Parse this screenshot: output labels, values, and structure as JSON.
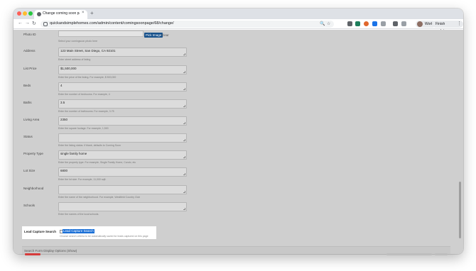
{
  "browser": {
    "tab_title": "Change coming soon page | ...",
    "tab_close": "×",
    "new_tab": "+",
    "nav_back": "←",
    "nav_forward": "→",
    "nav_reload": "↻",
    "url": "quickandsimplehomes.com/admin/content/comingsoonpage/68/change/",
    "profile_label": "Work",
    "finish_update_label": "Finish update",
    "menu_glyph": "⋮",
    "zoom_glyph": "🔍",
    "star_glyph": "☆"
  },
  "form": {
    "photo_id": {
      "label": "Photo ID",
      "help": "Select your comingsoon photo here",
      "pick_image": "Pick Image",
      "clear": "Clear"
    },
    "fields": [
      {
        "label": "Address",
        "value": "123 Main Street, San Diego, CA 92101",
        "help": "Enter street address of listing"
      },
      {
        "label": "List Price",
        "value": "$1,500,000",
        "help": "Enter the price of the listing. For example, $ 500,000"
      },
      {
        "label": "Beds",
        "value": "4",
        "help": "Enter the number of bedrooms. For example, 4"
      },
      {
        "label": "Baths",
        "value": "3.5",
        "help": "Enter the number of bathrooms. For example, 3.75"
      },
      {
        "label": "Living Area",
        "value": "2350",
        "help": "Enter the square footage. For example, 1,500"
      },
      {
        "label": "Status",
        "value": "",
        "help": "Enter the listing status. If blank, defaults to Coming Soon"
      },
      {
        "label": "Property Type",
        "value": "single family home",
        "help": "Enter the property type. For example, Single Family Home, Condo, etc"
      },
      {
        "label": "Lot Size",
        "value": "6800",
        "help": "Enter the lot size. For example, 11,000 sqft."
      },
      {
        "label": "Neighborhood",
        "value": "",
        "help": "Enter the name of the neighborhood. For example, Westfield Country Club"
      },
      {
        "label": "Schools",
        "value": "",
        "help": "Enter the names of the local schools."
      }
    ],
    "lead_capture": {
      "label": "Lead Capture Search",
      "checkbox_label": "Lead Capture Search",
      "checked": false,
      "help": "Choose search criteria to be automatically saved for leads captured on this page"
    },
    "search_form_display": {
      "label": "Search Form Display Options (Show)"
    }
  }
}
